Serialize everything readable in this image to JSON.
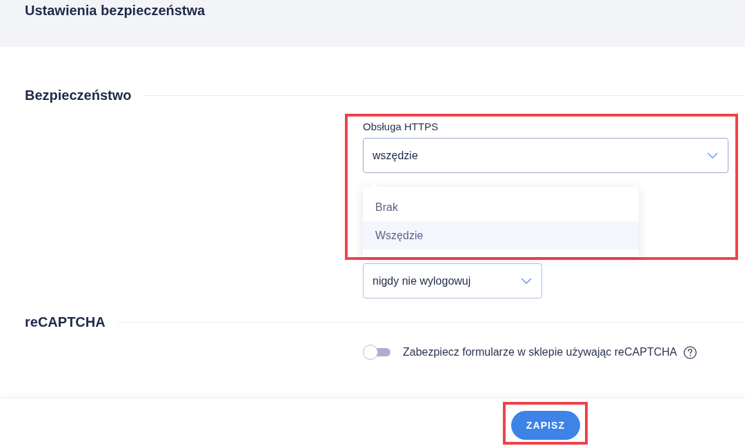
{
  "page": {
    "title": "Ustawienia bezpieczeństwa"
  },
  "sections": [
    {
      "title": "Bezpieczeństwo",
      "fields": [
        {
          "kind": "select",
          "label": "Obsługa HTTPS",
          "value": "wszędzie",
          "expanded": true,
          "highlighted": true,
          "options": [
            {
              "label": "Brak",
              "selected": false
            },
            {
              "label": "Wszędzie",
              "selected": true
            }
          ]
        },
        {
          "kind": "select",
          "value": "nigdy nie wylogowuj",
          "expanded": false,
          "highlighted": false
        }
      ]
    },
    {
      "title": "reCAPTCHA",
      "fields": [
        {
          "kind": "toggle",
          "label": "Zabezpiecz formularze w sklepie używając reCAPTCHA",
          "on": false,
          "help": true
        }
      ]
    }
  ],
  "footer": {
    "save_button": "ZAPISZ",
    "highlighted": true
  }
}
